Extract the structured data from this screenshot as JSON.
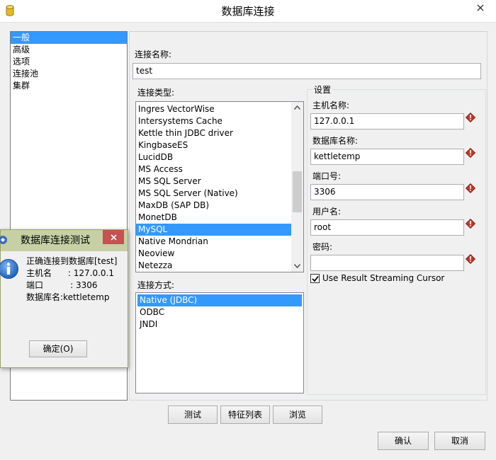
{
  "window": {
    "title": "数据库连接"
  },
  "nav": {
    "items": [
      "一般",
      "高级",
      "选项",
      "连接池",
      "集群"
    ],
    "selected": 0
  },
  "general": {
    "conn_name_label": "连接名称:",
    "conn_name_value": "test",
    "conn_type_label": "连接类型:",
    "conn_types": [
      "Ingres VectorWise",
      "Intersystems Cache",
      "Kettle thin JDBC driver",
      "KingbaseES",
      "LucidDB",
      "MS Access",
      "MS SQL Server",
      "MS SQL Server (Native)",
      "MaxDB (SAP DB)",
      "MonetDB",
      "MySQL",
      "Native Mondrian",
      "Neoview",
      "Netezza"
    ],
    "conn_type_selected": 10,
    "access_label": "连接方式:",
    "access_methods": [
      "Native (JDBC)",
      "ODBC",
      "JNDI"
    ],
    "access_selected": 0
  },
  "settings": {
    "group_label": "设置",
    "host_label": "主机名称:",
    "host_value": "127.0.0.1",
    "db_label": "数据库名称:",
    "db_value": "kettletemp",
    "port_label": "端口号:",
    "port_value": "3306",
    "user_label": "用户名:",
    "user_value": "root",
    "password_label": "密码:",
    "password_value": "",
    "streaming_label": "Use Result Streaming Cursor",
    "streaming_checked": true
  },
  "buttons": {
    "test": "测试",
    "features": "特征列表",
    "explore": "浏览",
    "ok": "确认",
    "cancel": "取消"
  },
  "dialog": {
    "title": "数据库连接测试",
    "line1": "正确连接到数据库[test]",
    "line2": "主机名      : 127.0.0.1",
    "line3": "端口          : 3306",
    "line4": "数据库名:kettletemp",
    "ok_label": "确定(O)"
  },
  "colors": {
    "selection": "#3399ff",
    "dialog_title": "#c7d0a4",
    "close_red": "#c75050",
    "required": "#c0392b"
  },
  "icons": {
    "app": "database-cylinder-icon",
    "required": "required-diamond-icon",
    "info": "info-icon"
  }
}
